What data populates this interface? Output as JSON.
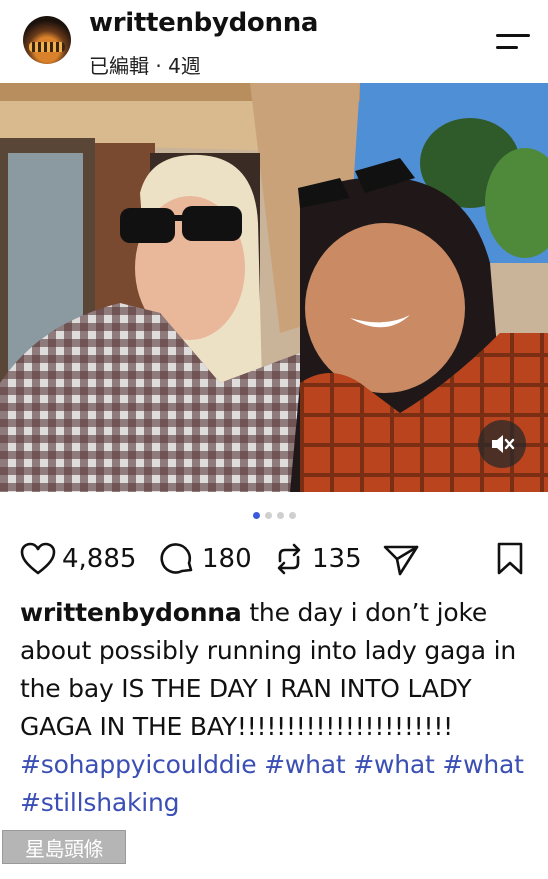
{
  "header": {
    "username": "writtenbydonna",
    "meta": "已編輯 · 4週"
  },
  "icons": {
    "avatar": "profile-avatar",
    "menu": "menu-icon",
    "mute": "speaker-muted-icon",
    "like": "heart-icon",
    "comment": "comment-bubble-icon",
    "repost": "repost-arrows-icon",
    "share": "send-paper-plane-icon",
    "save": "bookmark-icon"
  },
  "carousel": {
    "count": 4,
    "active_index": 0
  },
  "actions": {
    "likes": "4,885",
    "comments": "180",
    "reposts": "135"
  },
  "caption": {
    "username": "writtenbydonna",
    "text": " the day i don’t joke about possibly running into lady gaga in the bay IS THE DAY I RAN INTO LADY GAGA IN THE BAY!!!!!!!!!!!!!!!!!!!!!!",
    "hashtags": [
      "#sohappyicoulddie",
      "#what",
      "#what",
      "#what",
      "#stillshaking"
    ]
  },
  "watermark": "星島頭條",
  "colors": {
    "hashtag": "#3b4fb5",
    "active_dot": "#3b5bdb",
    "inactive_dot": "#cfcfcf"
  }
}
